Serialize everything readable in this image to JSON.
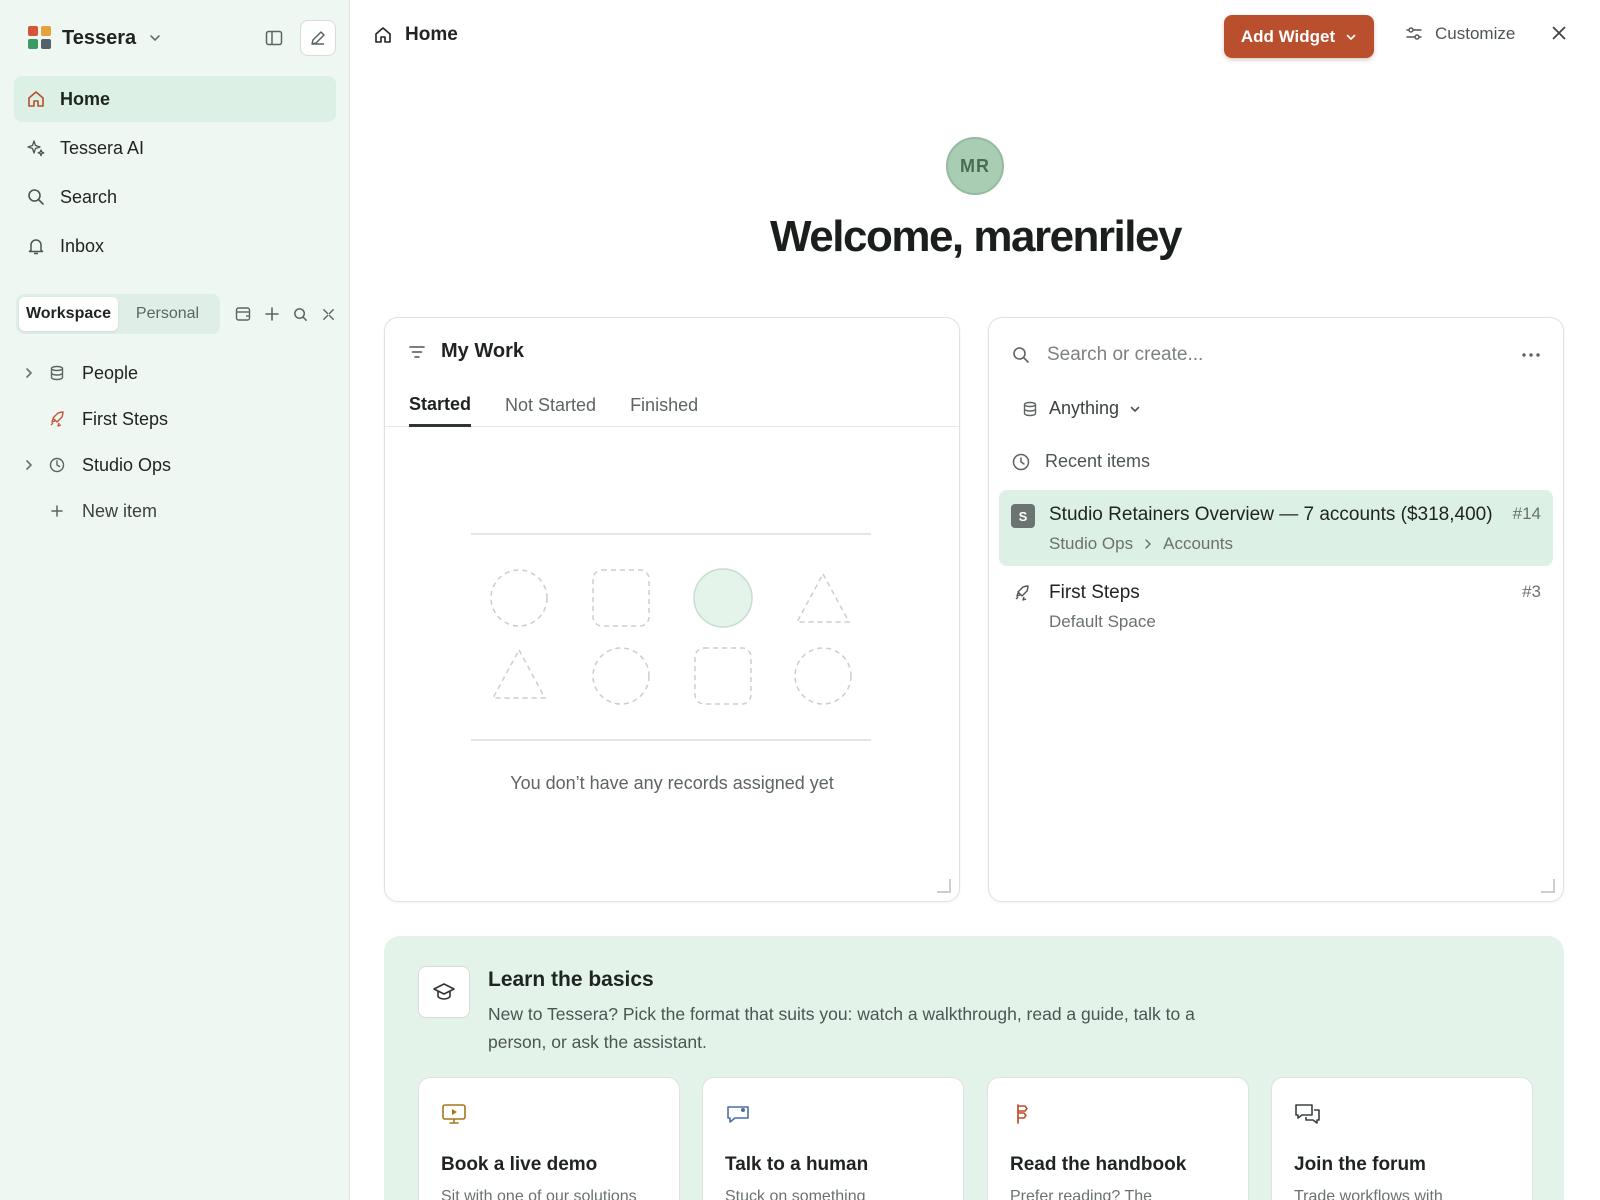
{
  "workspace": {
    "name": "Tessera",
    "logo_colors": [
      "#d4553a",
      "#e8a23b",
      "#3e9a64",
      "#55606b"
    ]
  },
  "nav": {
    "items": [
      {
        "label": "Home",
        "icon": "home-icon",
        "active": true
      },
      {
        "label": "Tessera AI",
        "icon": "sparkle-icon"
      },
      {
        "label": "Search",
        "icon": "search-icon"
      },
      {
        "label": "Inbox",
        "icon": "bell-icon"
      }
    ]
  },
  "scope": {
    "tabs": [
      "Workspace",
      "Personal"
    ],
    "selected": "Workspace"
  },
  "tree": {
    "items": [
      {
        "label": "People",
        "icon": "database-icon",
        "expandable": true
      },
      {
        "label": "First Steps",
        "icon": "rocket-icon",
        "expandable": false
      },
      {
        "label": "Studio Ops",
        "icon": "clock-icon",
        "expandable": true
      }
    ],
    "new_item_label": "New item"
  },
  "topbar": {
    "breadcrumb": "Home",
    "add_widget_label": "Add Widget",
    "customize_label": "Customize"
  },
  "welcome": {
    "avatar_initials": "MR",
    "greeting": "Welcome, marenriley"
  },
  "my_work": {
    "title": "My Work",
    "tabs": [
      "Started",
      "Not Started",
      "Finished"
    ],
    "selected_tab": "Started",
    "empty_message": "You don’t have any records assigned yet"
  },
  "search_widget": {
    "placeholder": "Search or create...",
    "filter_label": "Anything",
    "recent_label": "Recent items",
    "recent_items": [
      {
        "badge": "S",
        "title": "Studio Retainers Overview — 7 accounts ($318,400)",
        "path": [
          "Studio Ops",
          "Accounts"
        ],
        "number": "#14"
      },
      {
        "icon": "rocket-icon",
        "title": "First Steps",
        "subtitle": "Default Space",
        "number": "#3"
      }
    ]
  },
  "learn": {
    "title": "Learn the basics",
    "description": "New to Tessera? Pick the format that suits you: watch a walkthrough, read a guide, talk to a person, or ask the assistant.",
    "cards": [
      {
        "title": "Book a live demo",
        "icon": "presentation-icon",
        "icon_color": "#a8751f",
        "desc": "Sit with one of our solutions"
      },
      {
        "title": "Talk to a human",
        "icon": "chat-icon",
        "icon_color": "#4a6fa5",
        "desc": "Stuck on something"
      },
      {
        "title": "Read the handbook",
        "icon": "signpost-icon",
        "icon_color": "#b94f2c",
        "desc": "Prefer reading? The"
      },
      {
        "title": "Join the forum",
        "icon": "forum-icon",
        "icon_color": "#3b413e",
        "desc": "Trade workflows with"
      }
    ]
  },
  "colors": {
    "accent": "#b94f2c",
    "sidebar_bg": "#eef7f2",
    "active_nav": "#dcf0e5",
    "learn_bg": "#e3f3ea"
  }
}
